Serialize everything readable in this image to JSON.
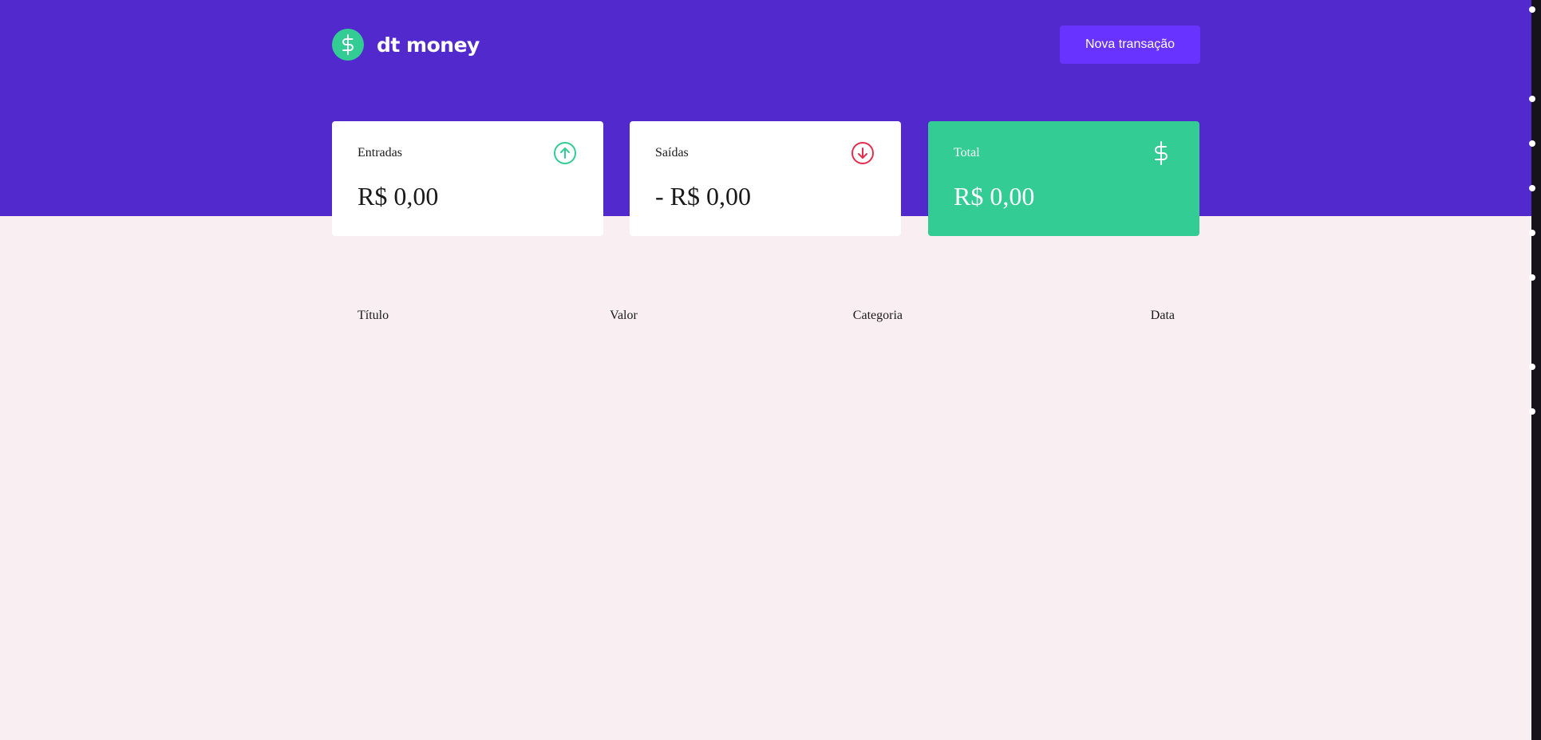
{
  "header": {
    "brand": "dt money",
    "new_transaction_label": "Nova transação"
  },
  "summary": {
    "income": {
      "label": "Entradas",
      "amount": "R$ 0,00"
    },
    "outcome": {
      "label": "Saídas",
      "amount": "- R$ 0,00"
    },
    "total": {
      "label": "Total",
      "amount": "R$ 0,00"
    }
  },
  "table": {
    "columns": [
      "Título",
      "Valor",
      "Categoria",
      "Data"
    ]
  },
  "colors": {
    "header_bg": "#5229cc",
    "button_bg": "#6933ff",
    "green": "#33cc95",
    "red": "#e52e4d",
    "page_bg": "#f9eff2"
  },
  "icons": {
    "logo": "dollar-sign-icon",
    "income": "arrow-up-circle-icon",
    "outcome": "arrow-down-circle-icon",
    "total": "dollar-sign-icon"
  }
}
